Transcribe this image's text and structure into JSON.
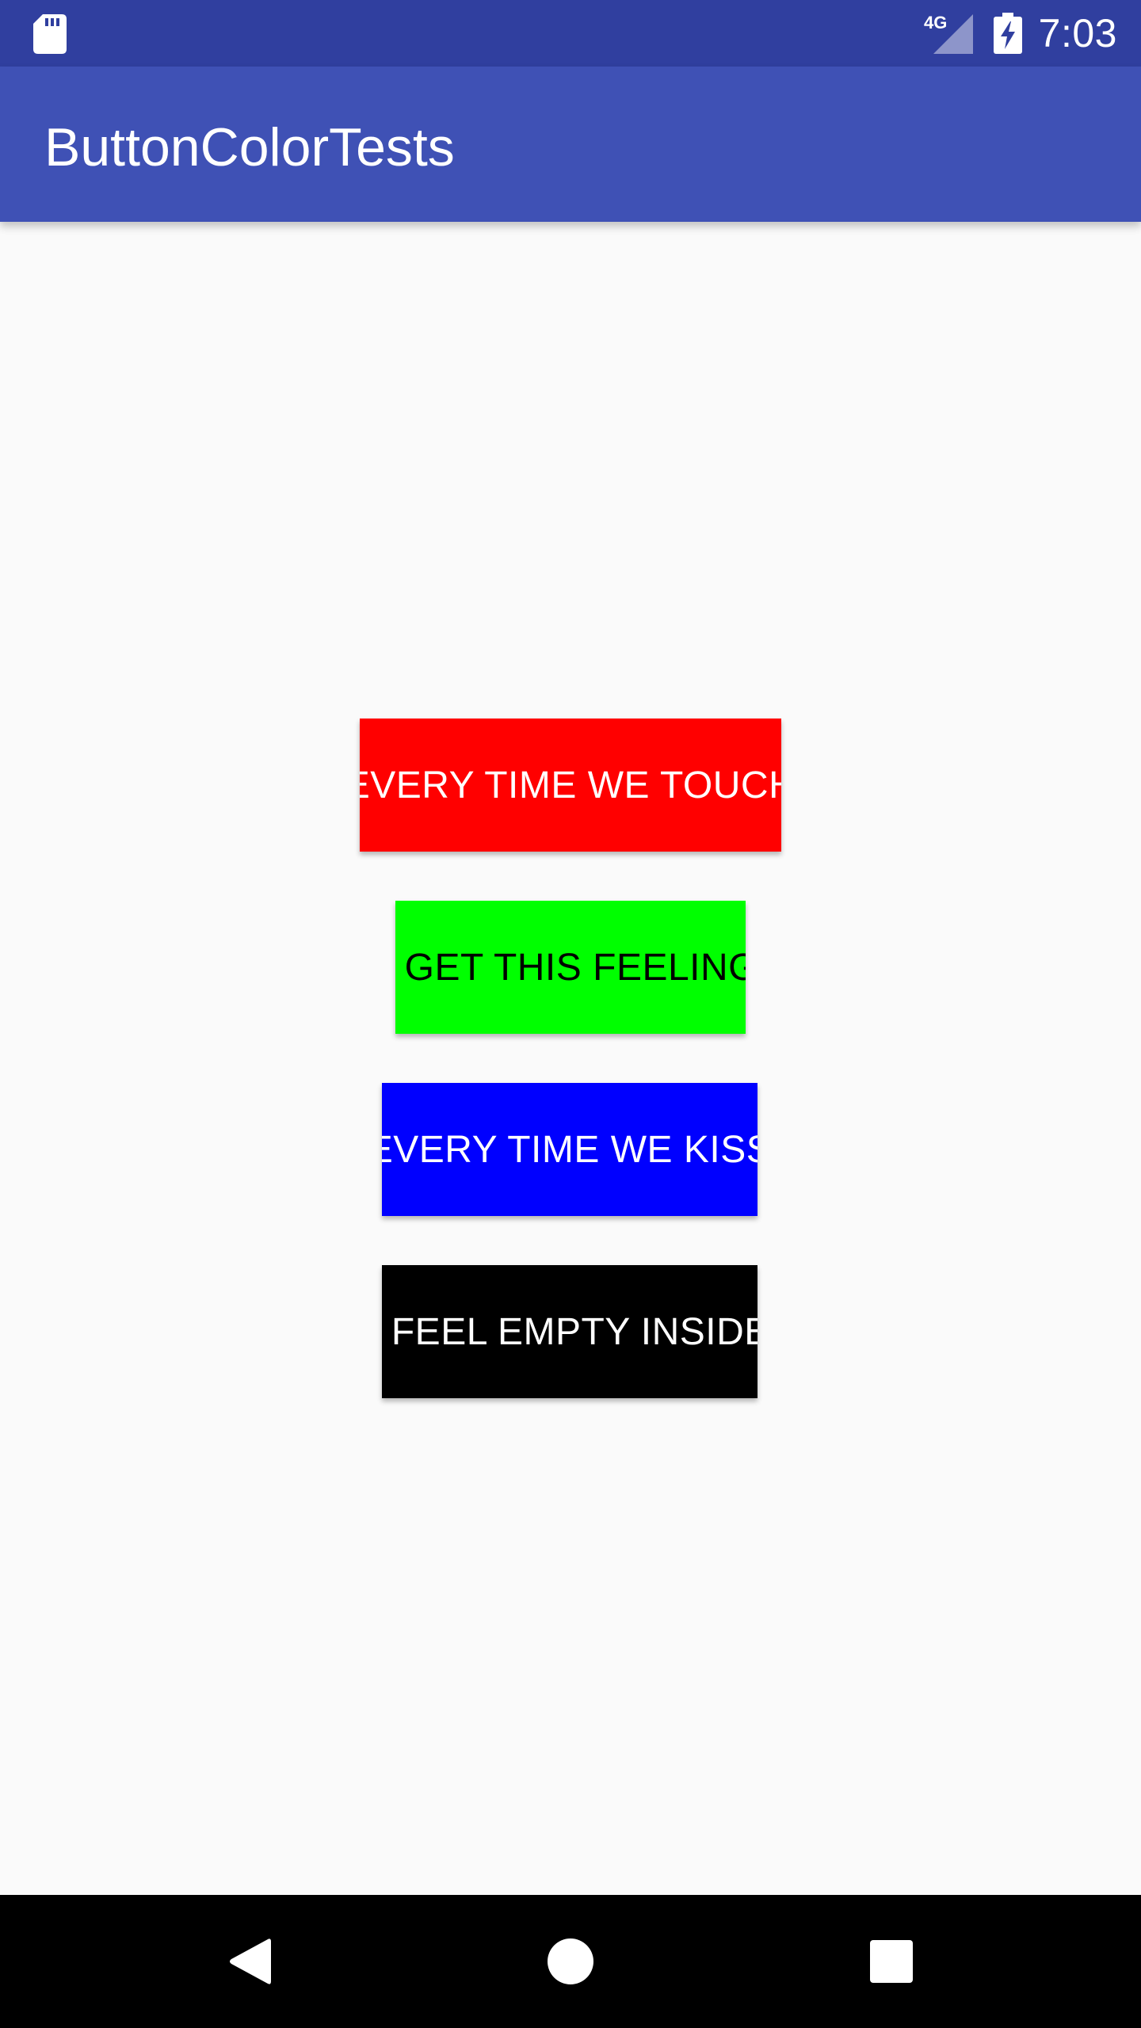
{
  "status_bar": {
    "network_label": "4G",
    "time": "7:03",
    "icons": [
      "sd-card-icon",
      "cellular-signal-icon",
      "battery-charging-icon"
    ]
  },
  "app_bar": {
    "title": "ButtonColorTests"
  },
  "buttons": [
    {
      "label": "EVERY TIME WE TOUCH",
      "background": "#ff0000",
      "text_color": "#ffffff"
    },
    {
      "label": "I GET THIS FEELING",
      "background": "#00ff00",
      "text_color": "#000000"
    },
    {
      "label": "EVERY TIME WE KISS",
      "background": "#0000ff",
      "text_color": "#ffffff"
    },
    {
      "label": "I FEEL EMPTY INSIDE",
      "background": "#000000",
      "text_color": "#ffffff"
    }
  ],
  "nav_bar": {
    "icons": [
      "back-icon",
      "home-icon",
      "recents-icon"
    ]
  },
  "colors": {
    "status_bar": "#303f9f",
    "app_bar": "#3f51b5",
    "background": "#fafafa",
    "nav_bar": "#000000"
  }
}
